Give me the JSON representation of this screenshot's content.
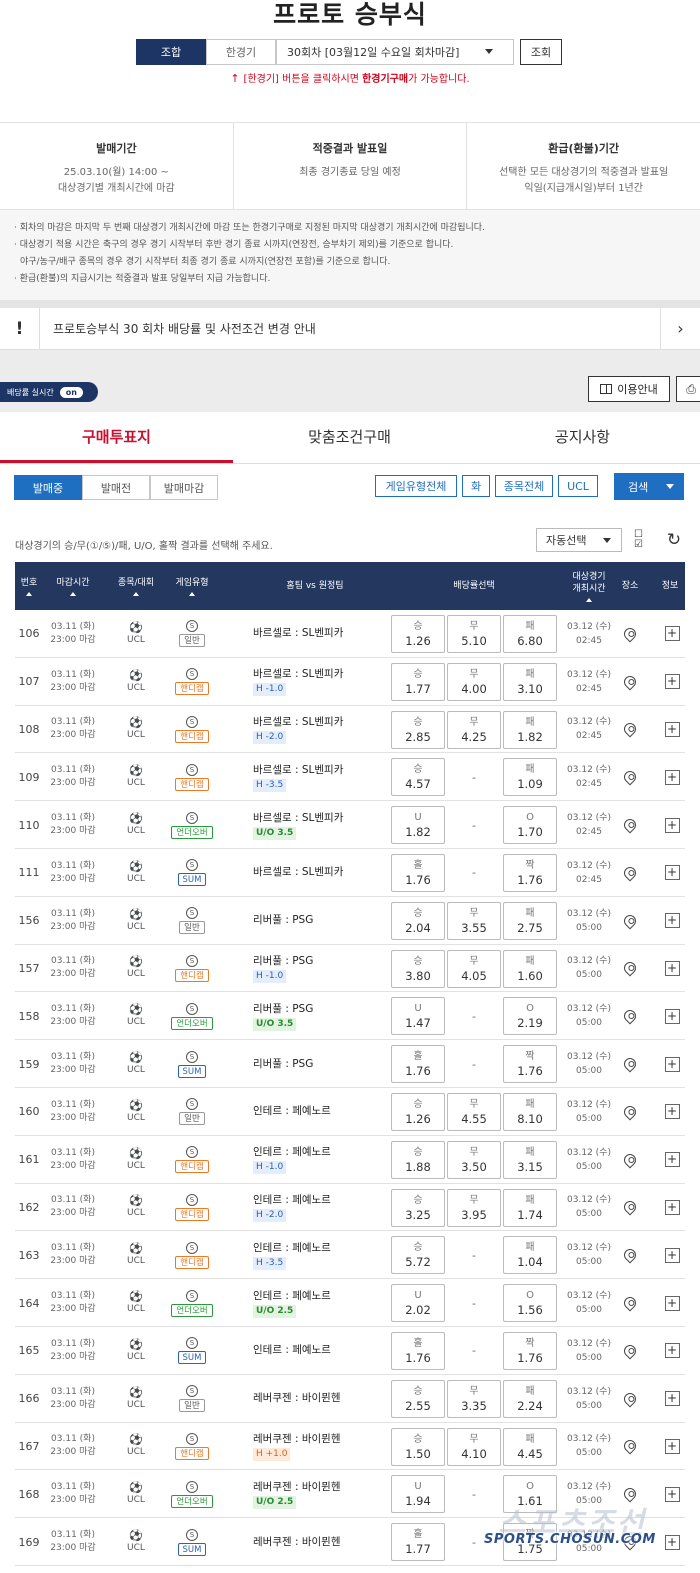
{
  "header": {
    "title": "프로토 승부식",
    "mode_tabs": [
      "조합",
      "한경기"
    ],
    "round_select": "30회차 [03월12일 수요일 회차마감]",
    "search_label": "조회",
    "notice_pre": "[한경기] 버튼을 클릭하시면 ",
    "notice_bold": "한경기구매",
    "notice_post": "가 가능합니다."
  },
  "info": {
    "sale": {
      "heading": "발매기간",
      "line1": "25.03.10(월) 14:00 ~",
      "line2": "대상경기별 개최시간에 마감"
    },
    "result": {
      "heading": "적중결과 발표일",
      "line1": "최종 경기종료 당일 예정"
    },
    "refund": {
      "heading": "환급(환불)기간",
      "line1": "선택한 모든 대상경기의 적중결과 발표일",
      "line2": "익일(지급개시일)부터 1년간"
    }
  },
  "rules": [
    "· 회차의 마감은 마지막 두 번째 대상경기 개최시간에 마감 또는 한경기구매로 지정된 마지막 대상경기 개최시간에 마감됩니다.",
    "· 대상경기 적용 시간은 축구의 경우 경기 시작부터 후반 경기 종료 시까지(연장전, 승부차기 제외)를 기준으로 합니다.",
    "  야구/농구/배구 종목의 경우 경기 시작부터 최종 경기 종료 시까지(연장전 포함)를 기준으로 합니다.",
    "· 환급(환불)의 지급시기는 적중결과 발표 당일부터 지급 가능합니다."
  ],
  "announcement": {
    "mark": "!",
    "text": "프로토승부식 30 회차 배당률 및 사전조건 변경 안내"
  },
  "toolbar": {
    "live_label": "배당률 실시간",
    "live_state": "on",
    "guide_label": "이용안내",
    "print_icon": "printer-icon"
  },
  "main_tabs": [
    "구매투표지",
    "맞춤조건구매",
    "공지사항"
  ],
  "status_tabs": [
    "발매중",
    "발매전",
    "발매마감"
  ],
  "filters": [
    "게임유형전체",
    "화",
    "종목전체",
    "UCL"
  ],
  "search2_label": "검색",
  "instruction": "대상경기의 승/무(①/⑤)/패, U/O, 홀짝 결과를 선택해 주세요.",
  "auto_select": "자동선택",
  "columns": {
    "no": "번호",
    "deadline": "마감시간",
    "sport": "종목/대회",
    "type": "게임유형",
    "match": "홈팀 vs 원정팀",
    "odds": "배당률선택",
    "start1": "대상경기",
    "start2": "개최시간",
    "venue": "장소",
    "info": "정보"
  },
  "rows": [
    {
      "no": "106",
      "date": "03.11 (화)",
      "close": "23:00 마감",
      "league": "UCL",
      "type": "일반",
      "tcls": "gen",
      "match": "바르셀로 : SL벤피카",
      "hc": "",
      "hcls": "",
      "o": [
        [
          "승",
          "1.26"
        ],
        [
          "무",
          "5.10"
        ],
        [
          "패",
          "6.80"
        ]
      ],
      "sd": "03.12 (수)",
      "st": "02:45"
    },
    {
      "no": "107",
      "date": "03.11 (화)",
      "close": "23:00 마감",
      "league": "UCL",
      "type": "핸디캡",
      "tcls": "hc",
      "match": "바르셀로 : SL벤피카",
      "hc": "H -1.0",
      "hcls": "blue",
      "o": [
        [
          "승",
          "1.77"
        ],
        [
          "무",
          "4.00"
        ],
        [
          "패",
          "3.10"
        ]
      ],
      "sd": "03.12 (수)",
      "st": "02:45"
    },
    {
      "no": "108",
      "date": "03.11 (화)",
      "close": "23:00 마감",
      "league": "UCL",
      "type": "핸디캡",
      "tcls": "hc",
      "match": "바르셀로 : SL벤피카",
      "hc": "H -2.0",
      "hcls": "blue",
      "o": [
        [
          "승",
          "2.85"
        ],
        [
          "무",
          "4.25"
        ],
        [
          "패",
          "1.82"
        ]
      ],
      "sd": "03.12 (수)",
      "st": "02:45"
    },
    {
      "no": "109",
      "date": "03.11 (화)",
      "close": "23:00 마감",
      "league": "UCL",
      "type": "핸디캡",
      "tcls": "hc",
      "match": "바르셀로 : SL벤피카",
      "hc": "H -3.5",
      "hcls": "blue",
      "o": [
        [
          "승",
          "4.57"
        ],
        null,
        [
          "패",
          "1.09"
        ]
      ],
      "sd": "03.12 (수)",
      "st": "02:45"
    },
    {
      "no": "110",
      "date": "03.11 (화)",
      "close": "23:00 마감",
      "league": "UCL",
      "type": "언더오버",
      "tcls": "uo",
      "match": "바르셀로 : SL벤피카",
      "hc": "U/O 3.5",
      "hcls": "green",
      "o": [
        [
          "U",
          "1.82"
        ],
        null,
        [
          "O",
          "1.70"
        ]
      ],
      "sd": "03.12 (수)",
      "st": "02:45"
    },
    {
      "no": "111",
      "date": "03.11 (화)",
      "close": "23:00 마감",
      "league": "UCL",
      "type": "SUM",
      "tcls": "sum",
      "match": "바르셀로 : SL벤피카",
      "hc": "",
      "hcls": "",
      "o": [
        [
          "홀",
          "1.76"
        ],
        null,
        [
          "짝",
          "1.76"
        ]
      ],
      "sd": "03.12 (수)",
      "st": "02:45"
    },
    {
      "no": "156",
      "date": "03.11 (화)",
      "close": "23:00 마감",
      "league": "UCL",
      "type": "일반",
      "tcls": "gen",
      "match": "리버풀 : PSG",
      "hc": "",
      "hcls": "",
      "o": [
        [
          "승",
          "2.04"
        ],
        [
          "무",
          "3.55"
        ],
        [
          "패",
          "2.75"
        ]
      ],
      "sd": "03.12 (수)",
      "st": "05:00"
    },
    {
      "no": "157",
      "date": "03.11 (화)",
      "close": "23:00 마감",
      "league": "UCL",
      "type": "핸디캡",
      "tcls": "hc",
      "match": "리버풀 : PSG",
      "hc": "H -1.0",
      "hcls": "blue",
      "o": [
        [
          "승",
          "3.80"
        ],
        [
          "무",
          "4.05"
        ],
        [
          "패",
          "1.60"
        ]
      ],
      "sd": "03.12 (수)",
      "st": "05:00"
    },
    {
      "no": "158",
      "date": "03.11 (화)",
      "close": "23:00 마감",
      "league": "UCL",
      "type": "언더오버",
      "tcls": "uo",
      "match": "리버풀 : PSG",
      "hc": "U/O 3.5",
      "hcls": "green",
      "o": [
        [
          "U",
          "1.47"
        ],
        null,
        [
          "O",
          "2.19"
        ]
      ],
      "sd": "03.12 (수)",
      "st": "05:00"
    },
    {
      "no": "159",
      "date": "03.11 (화)",
      "close": "23:00 마감",
      "league": "UCL",
      "type": "SUM",
      "tcls": "sum",
      "match": "리버풀 : PSG",
      "hc": "",
      "hcls": "",
      "o": [
        [
          "홀",
          "1.76"
        ],
        null,
        [
          "짝",
          "1.76"
        ]
      ],
      "sd": "03.12 (수)",
      "st": "05:00"
    },
    {
      "no": "160",
      "date": "03.11 (화)",
      "close": "23:00 마감",
      "league": "UCL",
      "type": "일반",
      "tcls": "gen",
      "match": "인테르 : 페예노르",
      "hc": "",
      "hcls": "",
      "o": [
        [
          "승",
          "1.26"
        ],
        [
          "무",
          "4.55"
        ],
        [
          "패",
          "8.10"
        ]
      ],
      "sd": "03.12 (수)",
      "st": "05:00"
    },
    {
      "no": "161",
      "date": "03.11 (화)",
      "close": "23:00 마감",
      "league": "UCL",
      "type": "핸디캡",
      "tcls": "hc",
      "match": "인테르 : 페예노르",
      "hc": "H -1.0",
      "hcls": "blue",
      "o": [
        [
          "승",
          "1.88"
        ],
        [
          "무",
          "3.50"
        ],
        [
          "패",
          "3.15"
        ]
      ],
      "sd": "03.12 (수)",
      "st": "05:00"
    },
    {
      "no": "162",
      "date": "03.11 (화)",
      "close": "23:00 마감",
      "league": "UCL",
      "type": "핸디캡",
      "tcls": "hc",
      "match": "인테르 : 페예노르",
      "hc": "H -2.0",
      "hcls": "blue",
      "o": [
        [
          "승",
          "3.25"
        ],
        [
          "무",
          "3.95"
        ],
        [
          "패",
          "1.74"
        ]
      ],
      "sd": "03.12 (수)",
      "st": "05:00"
    },
    {
      "no": "163",
      "date": "03.11 (화)",
      "close": "23:00 마감",
      "league": "UCL",
      "type": "핸디캡",
      "tcls": "hc",
      "match": "인테르 : 페예노르",
      "hc": "H -3.5",
      "hcls": "blue",
      "o": [
        [
          "승",
          "5.72"
        ],
        null,
        [
          "패",
          "1.04"
        ]
      ],
      "sd": "03.12 (수)",
      "st": "05:00"
    },
    {
      "no": "164",
      "date": "03.11 (화)",
      "close": "23:00 마감",
      "league": "UCL",
      "type": "언더오버",
      "tcls": "uo",
      "match": "인테르 : 페예노르",
      "hc": "U/O 2.5",
      "hcls": "green",
      "o": [
        [
          "U",
          "2.02"
        ],
        null,
        [
          "O",
          "1.56"
        ]
      ],
      "sd": "03.12 (수)",
      "st": "05:00"
    },
    {
      "no": "165",
      "date": "03.11 (화)",
      "close": "23:00 마감",
      "league": "UCL",
      "type": "SUM",
      "tcls": "sum",
      "match": "인테르 : 페예노르",
      "hc": "",
      "hcls": "",
      "o": [
        [
          "홀",
          "1.76"
        ],
        null,
        [
          "짝",
          "1.76"
        ]
      ],
      "sd": "03.12 (수)",
      "st": "05:00"
    },
    {
      "no": "166",
      "date": "03.11 (화)",
      "close": "23:00 마감",
      "league": "UCL",
      "type": "일반",
      "tcls": "gen",
      "match": "레버쿠젠 : 바이뮌헨",
      "hc": "",
      "hcls": "",
      "o": [
        [
          "승",
          "2.55"
        ],
        [
          "무",
          "3.35"
        ],
        [
          "패",
          "2.24"
        ]
      ],
      "sd": "03.12 (수)",
      "st": "05:00"
    },
    {
      "no": "167",
      "date": "03.11 (화)",
      "close": "23:00 마감",
      "league": "UCL",
      "type": "핸디캡",
      "tcls": "hc",
      "match": "레버쿠젠 : 바이뮌헨",
      "hc": "H +1.0",
      "hcls": "orange",
      "o": [
        [
          "승",
          "1.50"
        ],
        [
          "무",
          "4.10"
        ],
        [
          "패",
          "4.45"
        ]
      ],
      "sd": "03.12 (수)",
      "st": "05:00"
    },
    {
      "no": "168",
      "date": "03.11 (화)",
      "close": "23:00 마감",
      "league": "UCL",
      "type": "언더오버",
      "tcls": "uo",
      "match": "레버쿠젠 : 바이뮌헨",
      "hc": "U/O 2.5",
      "hcls": "green",
      "o": [
        [
          "U",
          "1.94"
        ],
        null,
        [
          "O",
          "1.61"
        ]
      ],
      "sd": "03.12 (수)",
      "st": "05:00"
    },
    {
      "no": "169",
      "date": "03.11 (화)",
      "close": "23:00 마감",
      "league": "UCL",
      "type": "SUM",
      "tcls": "sum",
      "match": "레버쿠젠 : 바이뮌헨",
      "hc": "",
      "hcls": "",
      "o": [
        [
          "홀",
          "1.77"
        ],
        null,
        [
          "짝",
          "1.75"
        ]
      ],
      "sd": "03.12 (수)",
      "st": "05:00"
    }
  ],
  "watermark": {
    "big": "스포츠조선",
    "url": "SPORTS.CHOSUN.COM"
  }
}
